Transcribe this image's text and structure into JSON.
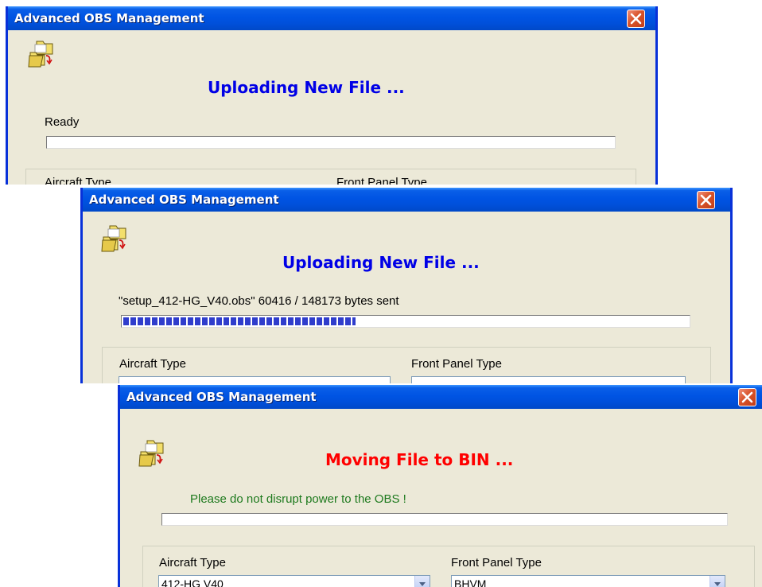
{
  "dialogs": [
    {
      "title": "Advanced OBS Management",
      "heading": "Uploading New File ...",
      "status": "Ready",
      "progress_percent": 0,
      "aircraft_label": "Aircraft Type",
      "front_panel_label": "Front Panel Type"
    },
    {
      "title": "Advanced OBS Management",
      "heading": "Uploading New File ...",
      "status": "\"setup_412-HG_V40.obs\"  60416 / 148173 bytes sent",
      "progress_percent": 41,
      "aircraft_label": "Aircraft Type",
      "front_panel_label": "Front Panel Type"
    },
    {
      "title": "Advanced OBS Management",
      "heading": "Moving File to BIN ...",
      "status": "Please do not disrupt power to the OBS !",
      "progress_percent": 0,
      "aircraft_label": "Aircraft Type",
      "front_panel_label": "Front Panel Type",
      "aircraft_value": "412-HG V40",
      "front_panel_value": "BHVM"
    }
  ],
  "colors": {
    "heading_blue": "#0000e6",
    "heading_red": "#ff0000",
    "status_green": "#1e7a1e",
    "titlebar": "#0054e3",
    "close_button": "#d8542b",
    "progress_fill": "#2f3dcc"
  },
  "icons": {
    "app_icon": "file-transfer-folder-icon",
    "close_icon": "close-x-icon",
    "dropdown_icon": "chevron-down-icon"
  }
}
